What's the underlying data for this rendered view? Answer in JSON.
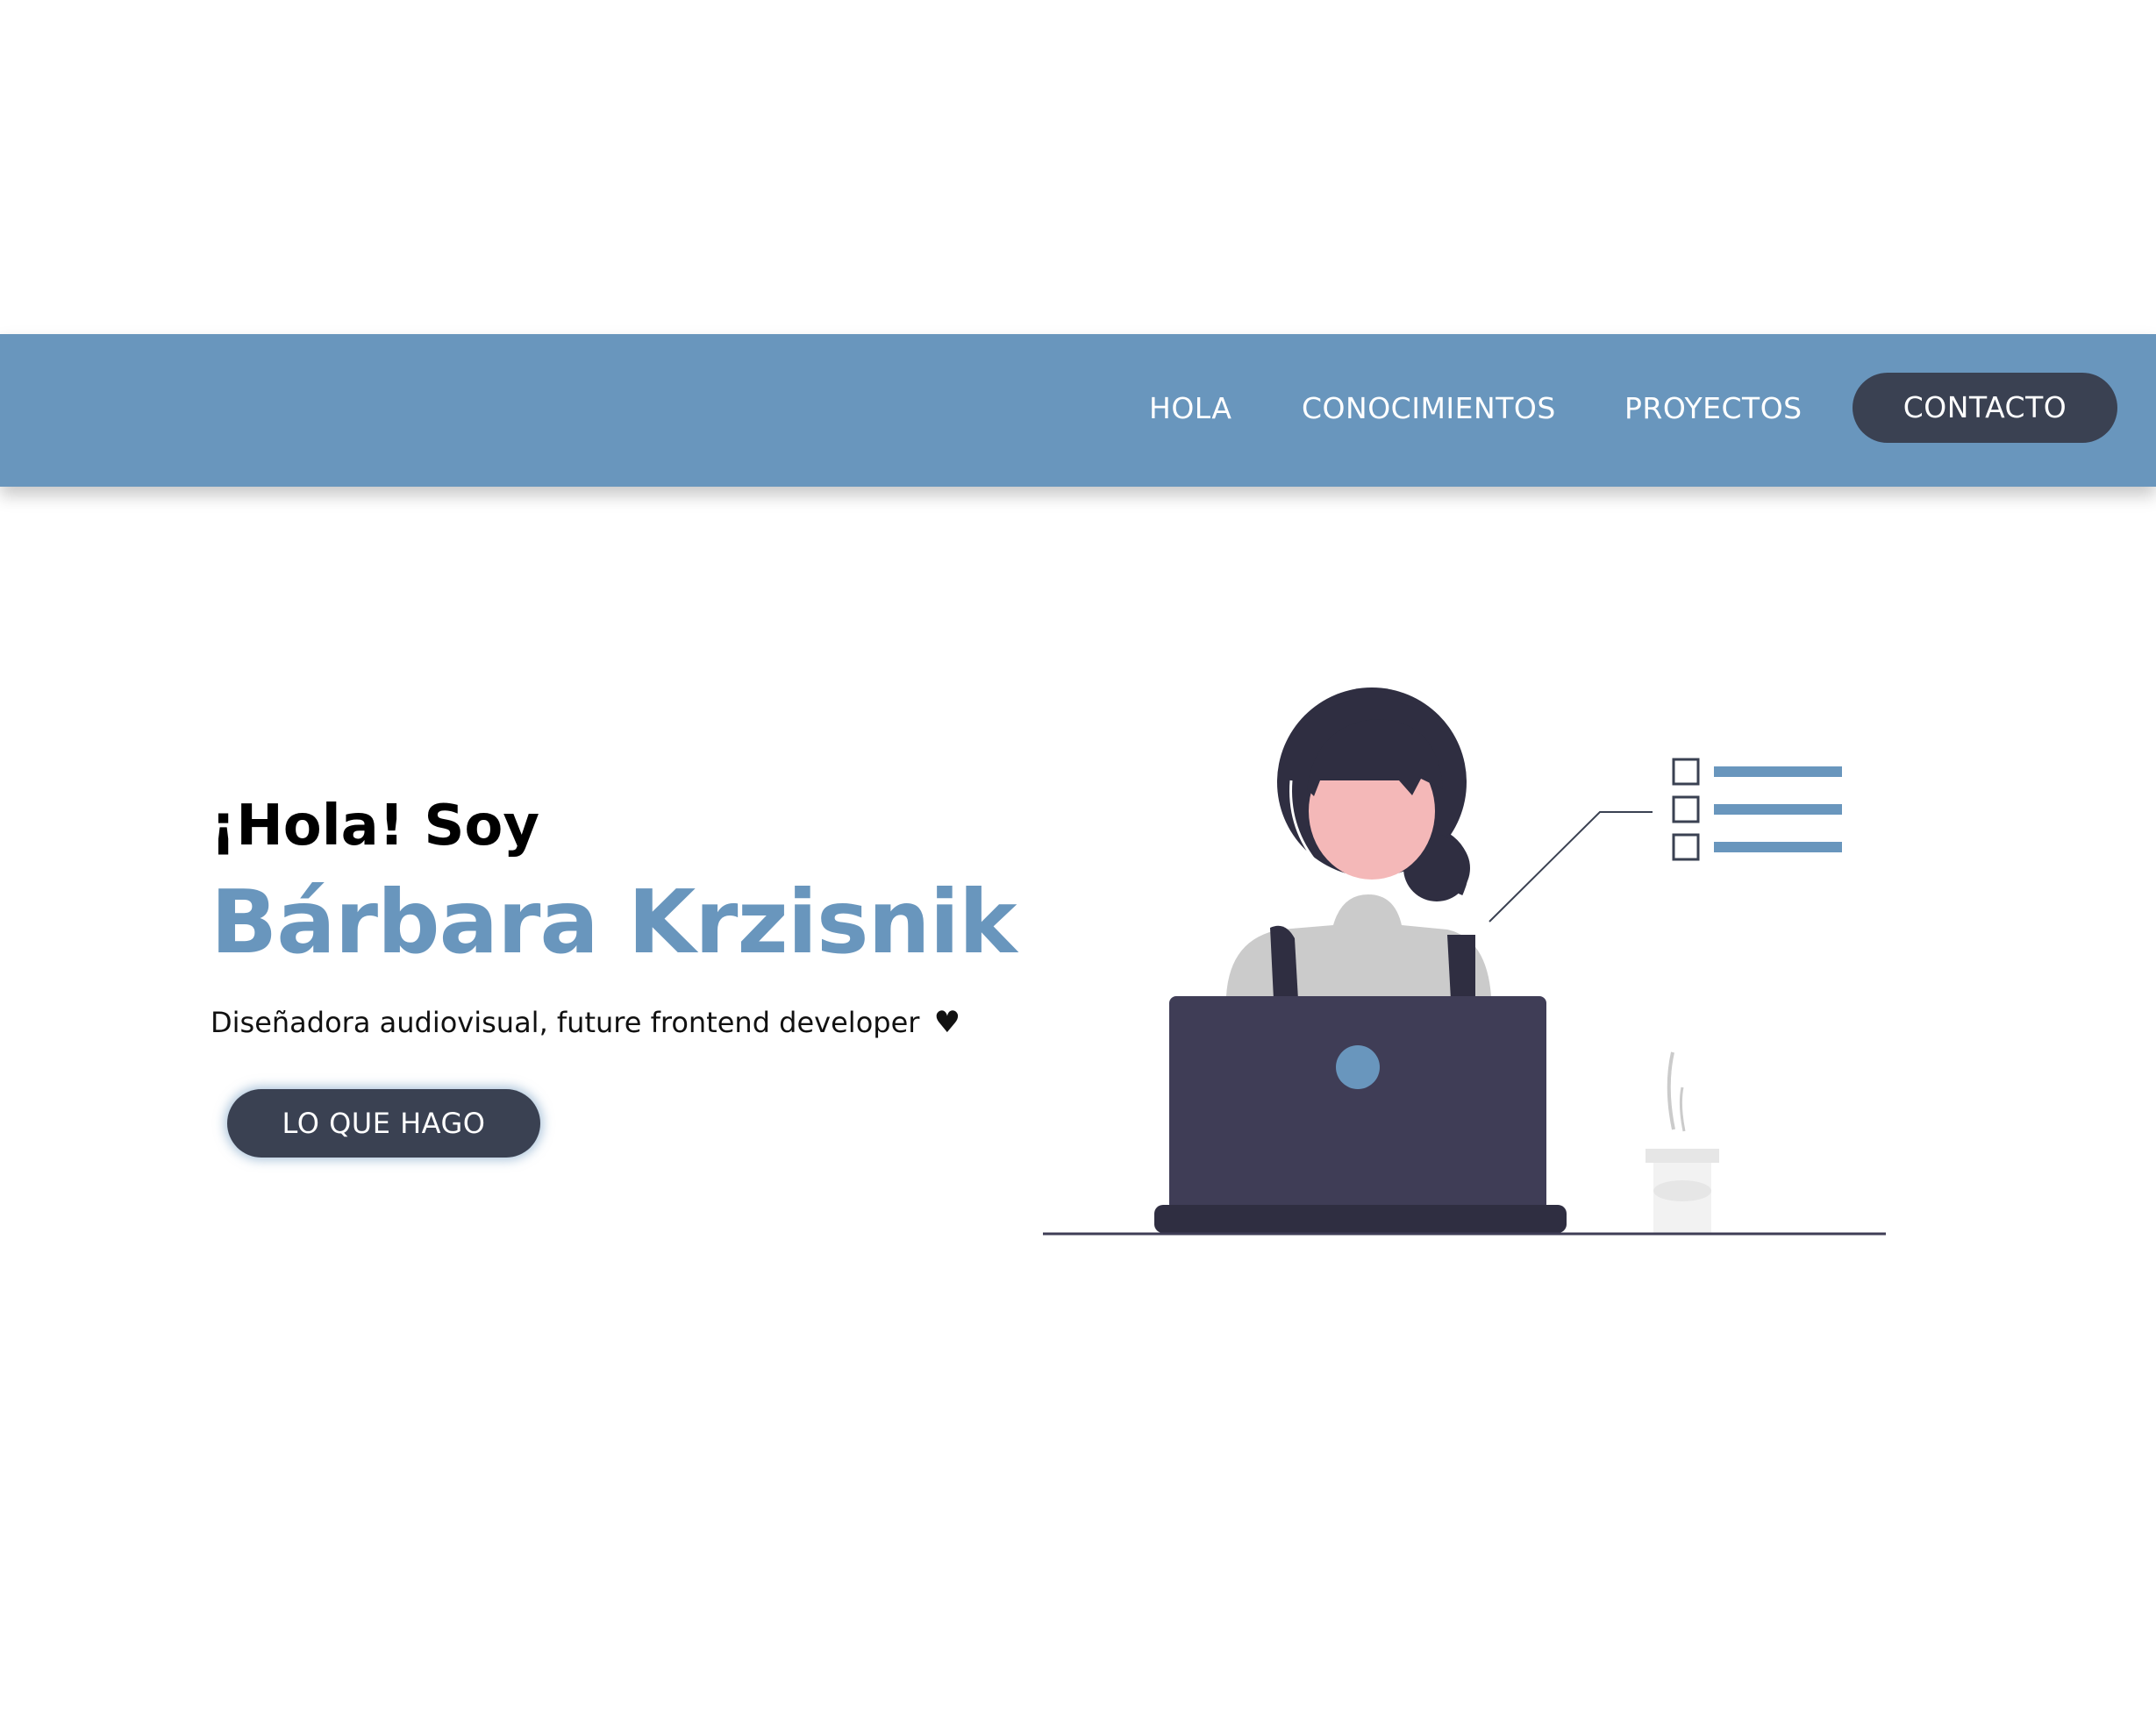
{
  "nav": {
    "items": [
      {
        "label": "HOLA"
      },
      {
        "label": "CONOCIMIENTOS"
      },
      {
        "label": "PROYECTOS"
      }
    ],
    "contact_label": "CONTACTO"
  },
  "hero": {
    "greeting": "¡Hola! Soy",
    "name": "Bárbara Krzisnik",
    "subtitle": "Diseñadora audiovisual, future frontend developer",
    "heart": "♥",
    "cta_label": "LO QUE HAGO"
  },
  "colors": {
    "accent": "#6996bd",
    "dark": "#3a4152",
    "background": "#ffffff"
  },
  "icons": {
    "illustration": "woman-at-laptop-illustration",
    "heart": "heart-icon"
  }
}
